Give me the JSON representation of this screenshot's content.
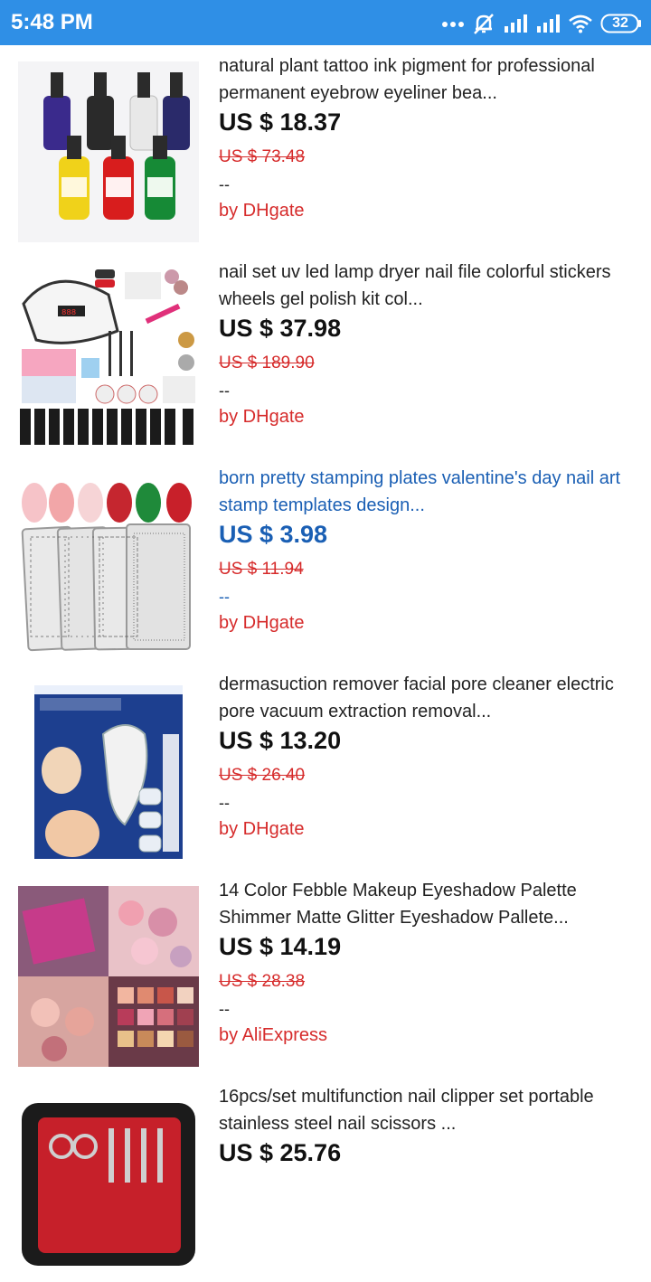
{
  "status_bar": {
    "time": "5:48 PM",
    "battery": "32",
    "icons": [
      "more-dots-icon",
      "mute-icon",
      "signal-icon",
      "signal-icon",
      "wifi-icon",
      "battery-icon"
    ]
  },
  "products": [
    {
      "title": "natural plant tattoo ink pigment for professional permanent eyebrow eyeliner bea...",
      "price": "US $ 18.37",
      "original_price": "US $ 73.48",
      "note": "--",
      "seller": "by DHgate",
      "image": "tattoo-ink-bottles-image"
    },
    {
      "title": "nail set uv led lamp dryer nail file colorful stickers wheels gel polish kit col...",
      "price": "US $ 37.98",
      "original_price": "US $ 189.90",
      "note": "--",
      "seller": "by DHgate",
      "image": "nail-kit-image"
    },
    {
      "title": "born pretty stamping plates valentine's day nail art stamp templates design...",
      "price": "US $ 3.98",
      "original_price": "US $ 11.94",
      "note": "--",
      "seller": "by DHgate",
      "image": "stamping-plates-image",
      "highlighted": true
    },
    {
      "title": "dermasuction remover facial pore cleaner electric pore vacuum extraction removal...",
      "price": "US $ 13.20",
      "original_price": "US $ 26.40",
      "note": "--",
      "seller": "by DHgate",
      "image": "pore-vacuum-image"
    },
    {
      "title": "14 Color Febble Makeup Eyeshadow Palette Shimmer Matte Glitter Eyeshadow Pallete...",
      "price": "US $ 14.19",
      "original_price": "US $ 28.38",
      "note": "--",
      "seller": "by AliExpress",
      "image": "eyeshadow-palette-image"
    },
    {
      "title": "16pcs/set multifunction nail clipper set portable stainless steel nail scissors ...",
      "price": "US $ 25.76",
      "original_price": "",
      "note": "",
      "seller": "",
      "image": "nail-clipper-set-image"
    }
  ],
  "colors": {
    "status_bar": "#2f8fe6",
    "price_red": "#d62b2b",
    "link_blue": "#1a5fb4"
  }
}
